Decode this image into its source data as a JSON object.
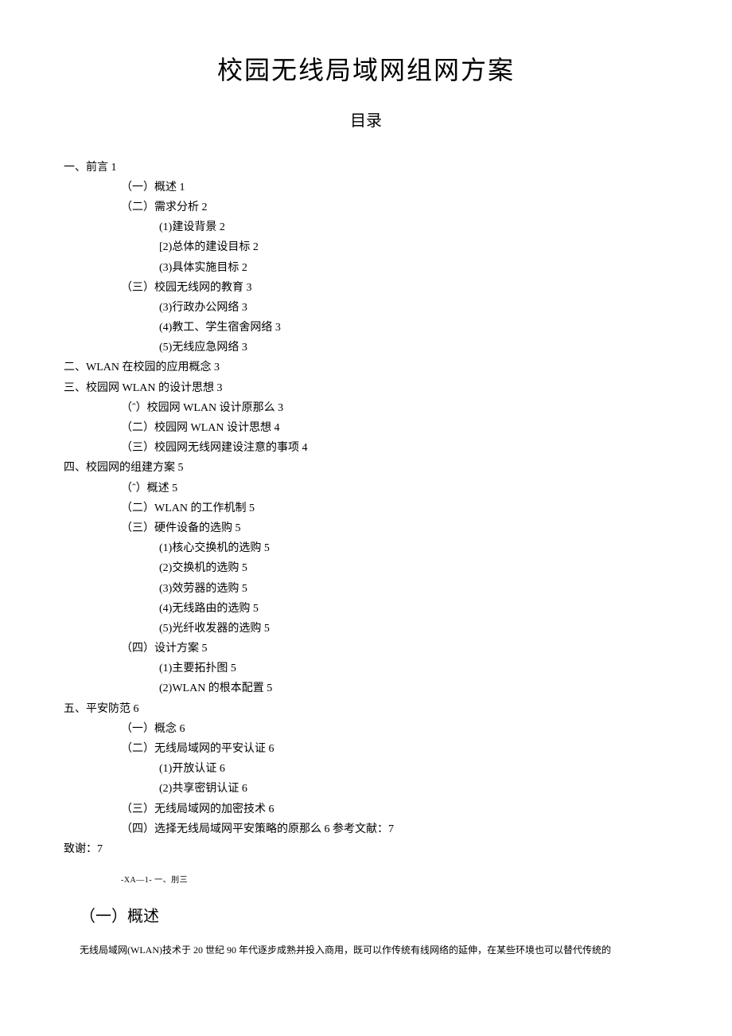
{
  "title": "校园无线局域网组网方案",
  "toc_heading": "目录",
  "toc": [
    {
      "cls": "toc-l1",
      "text": "一、前言 1"
    },
    {
      "cls": "toc-l2",
      "text": "（一）概述 1"
    },
    {
      "cls": "toc-l2",
      "text": "（二）需求分析 2"
    },
    {
      "cls": "toc-l3",
      "text": "(1)建设背景 2"
    },
    {
      "cls": "toc-l3",
      "text": "[2)总体的建设目标 2"
    },
    {
      "cls": "toc-l3",
      "text": "(3)具体实施目标 2"
    },
    {
      "cls": "toc-l2",
      "text": "（三）校园无线网的教育 3"
    },
    {
      "cls": "toc-l3",
      "text": "(3)行政办公网络 3"
    },
    {
      "cls": "toc-l3",
      "text": "(4)教工、学生宿舍网络 3"
    },
    {
      "cls": "toc-l3",
      "text": "(5)无线应急网络 3"
    },
    {
      "cls": "toc-l1",
      "text": "二、WLAN 在校园的应用概念 3"
    },
    {
      "cls": "toc-l1",
      "text": "三、校园网 WLAN 的设计思想 3"
    },
    {
      "cls": "toc-l2",
      "text": "（ˆ）校园网 WLAN 设计原那么 3"
    },
    {
      "cls": "toc-l2",
      "text": "（二）校园网 WLAN 设计思想 4"
    },
    {
      "cls": "toc-l2",
      "text": "（三）校园网无线网建设注意的事项 4"
    },
    {
      "cls": "toc-l1",
      "text": "四、校园网的组建方案 5"
    },
    {
      "cls": "toc-l2",
      "text": "（ˆ）概述 5"
    },
    {
      "cls": "toc-l2",
      "text": "（二）WLAN 的工作机制 5"
    },
    {
      "cls": "toc-l2",
      "text": "（三）硬件设备的选购 5"
    },
    {
      "cls": "toc-l3",
      "text": "(1)核心交换机的选购 5"
    },
    {
      "cls": "toc-l3",
      "text": "(2)交换机的选购 5"
    },
    {
      "cls": "toc-l3",
      "text": "(3)效劳器的选购 5"
    },
    {
      "cls": "toc-l3",
      "text": "(4)无线路由的选购 5"
    },
    {
      "cls": "toc-l3",
      "text": "(5)光纤收发器的选购 5"
    },
    {
      "cls": "toc-l2",
      "text": "（四）设计方案 5"
    },
    {
      "cls": "toc-l3",
      "text": "(1)主要拓扑图 5"
    },
    {
      "cls": "toc-l3",
      "text": "(2)WLAN 的根本配置 5"
    },
    {
      "cls": "toc-l1",
      "text": "五、平安防范 6"
    },
    {
      "cls": "toc-l2",
      "text": "（一）概念 6"
    },
    {
      "cls": "toc-l2",
      "text": "（二）无线局域网的平安认证 6"
    },
    {
      "cls": "toc-l3",
      "text": "(1)开放认证 6"
    },
    {
      "cls": "toc-l3",
      "text": "(2)共享密钥认证 6"
    },
    {
      "cls": "toc-l2",
      "text": "（三）无线局域网的加密技术 6"
    },
    {
      "cls": "toc-l2",
      "text": "（四）选择无线局域网平安策略的原那么 6 参考文献：7"
    },
    {
      "cls": "toc-l1",
      "text": "致谢：7"
    }
  ],
  "small_note": "-XA—1- 一、刖三",
  "overview_heading": "（一）概述",
  "body_paragraph": "无线局域网(WLAN)技术于 20 世纪 90 年代逐步成熟并投入商用，既可以作传统有线网络的延伸，在某些环境也可以替代传统的"
}
